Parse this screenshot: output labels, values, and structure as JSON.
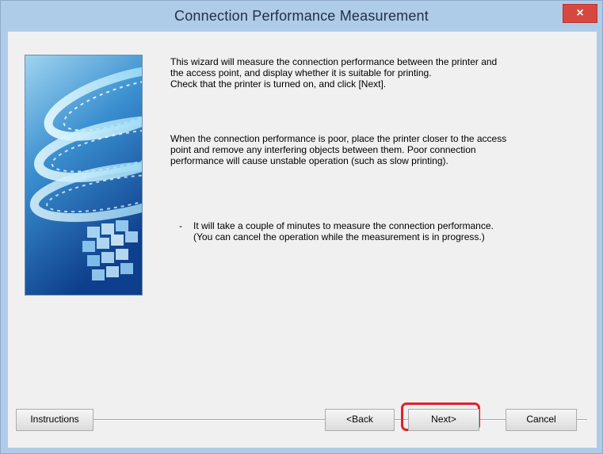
{
  "window": {
    "title": "Connection Performance Measurement",
    "close_label": "×"
  },
  "content": {
    "paragraph1": "This wizard will measure the connection performance between the printer and\nthe access point, and display whether it is suitable for printing.\nCheck that the printer is turned on, and click [Next].",
    "paragraph2": "When the connection performance is poor, place the printer closer to the access\npoint and remove any interfering objects between them. Poor connection\nperformance will cause unstable operation (such as slow printing).",
    "bullet_mark": "-",
    "bullet_text": "It will take a couple of minutes to measure the connection performance.\n(You can cancel the operation while the measurement is in progress.)"
  },
  "buttons": {
    "instructions": "Instructions",
    "back": "<Back",
    "next": "Next>",
    "cancel": "Cancel"
  },
  "colors": {
    "title_bar": "#aecbe8",
    "close_button": "#d6473f",
    "highlight": "#e0202a",
    "dialog_background": "#f0f0f0"
  }
}
